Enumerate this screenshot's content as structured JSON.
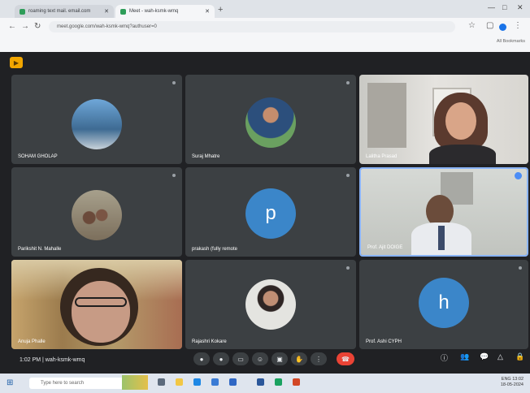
{
  "browser": {
    "tabs": [
      {
        "label": "roaming text mail. email.com"
      },
      {
        "label": "Meet - wah-ksmk-wmq"
      }
    ],
    "url": "meet.google.com/wah-ksmk-wmq?authuser=0",
    "bookmarks_label": "All Bookmarks"
  },
  "meeting": {
    "time": "1:02 PM",
    "code": "wah-ksmk-wmq",
    "participants": [
      {
        "name": "SOHAM GHOLAP",
        "kind": "avatar"
      },
      {
        "name": "Suraj Mhatre",
        "kind": "avatar"
      },
      {
        "name": "Lalitha Prasad",
        "kind": "video"
      },
      {
        "name": "Parikshit N. Mahalle",
        "kind": "avatar"
      },
      {
        "name": "prakash (fully remote",
        "kind": "letter",
        "letter": "p"
      },
      {
        "name": "Prof. Ajit DOIGE",
        "kind": "video"
      },
      {
        "name": "Anuja Phalle",
        "kind": "video"
      },
      {
        "name": "Rajashri Kokare",
        "kind": "avatar"
      },
      {
        "name": "Prof. Ashi CYPH",
        "kind": "letter",
        "letter": "h"
      }
    ]
  },
  "taskbar": {
    "search_placeholder": "Type here to search",
    "tray_time": "13:02",
    "tray_date": "18-05-2024",
    "tray_lang": "ENG"
  },
  "icons": {
    "mic": "microphone-icon",
    "camera": "camera-icon",
    "captions": "captions-icon",
    "emoji": "emoji-icon",
    "present": "present-icon",
    "hand": "raise-hand-icon",
    "more": "more-icon",
    "end": "end-call-icon"
  }
}
